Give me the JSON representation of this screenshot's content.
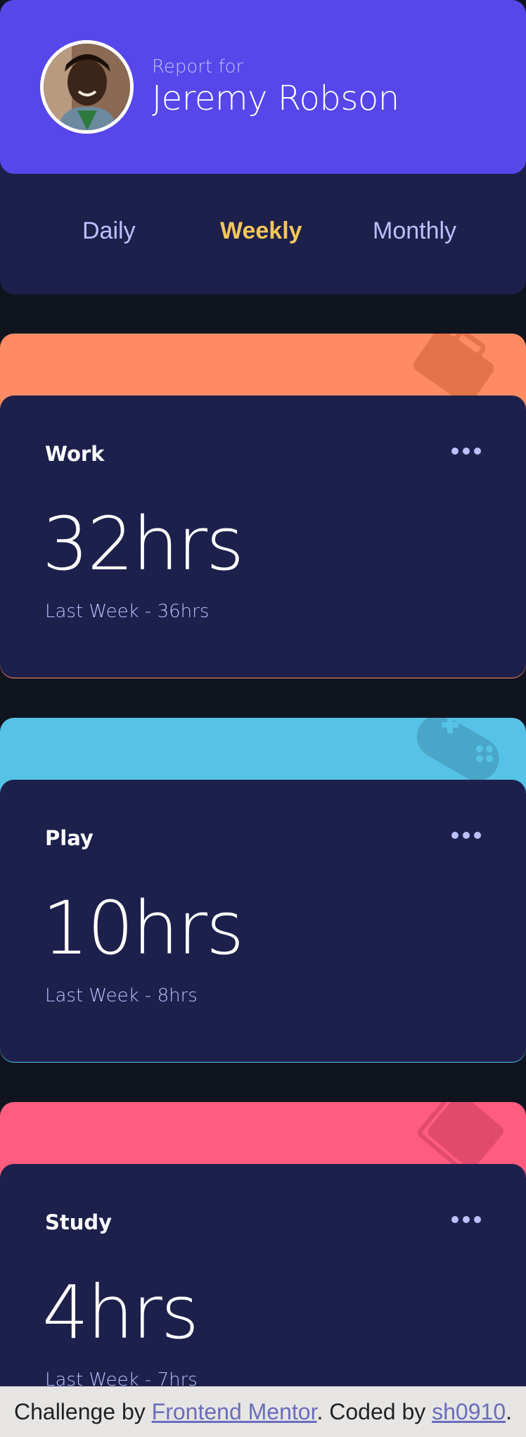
{
  "profile": {
    "report_label": "Report for",
    "name": "Jeremy Robson",
    "accent_color": "#5746ea"
  },
  "tabs": [
    {
      "label": "Daily",
      "active": false
    },
    {
      "label": "Weekly",
      "active": true
    },
    {
      "label": "Monthly",
      "active": false
    }
  ],
  "activities": [
    {
      "title": "Work",
      "hours": "32hrs",
      "previous": "Last Week - 36hrs",
      "color": "#ff8b64",
      "icon": "briefcase-icon"
    },
    {
      "title": "Play",
      "hours": "10hrs",
      "previous": "Last Week - 8hrs",
      "color": "#56c2e6",
      "icon": "gamepad-icon"
    },
    {
      "title": "Study",
      "hours": "4hrs",
      "previous": "Last Week - 7hrs",
      "color": "#ff5d7f",
      "icon": "book-icon"
    }
  ],
  "footer": {
    "prefix": "Challenge by",
    "mentor_link": "Frontend Mentor",
    "middle": ". Coded by",
    "author_link": "sh0910",
    "suffix": "."
  }
}
